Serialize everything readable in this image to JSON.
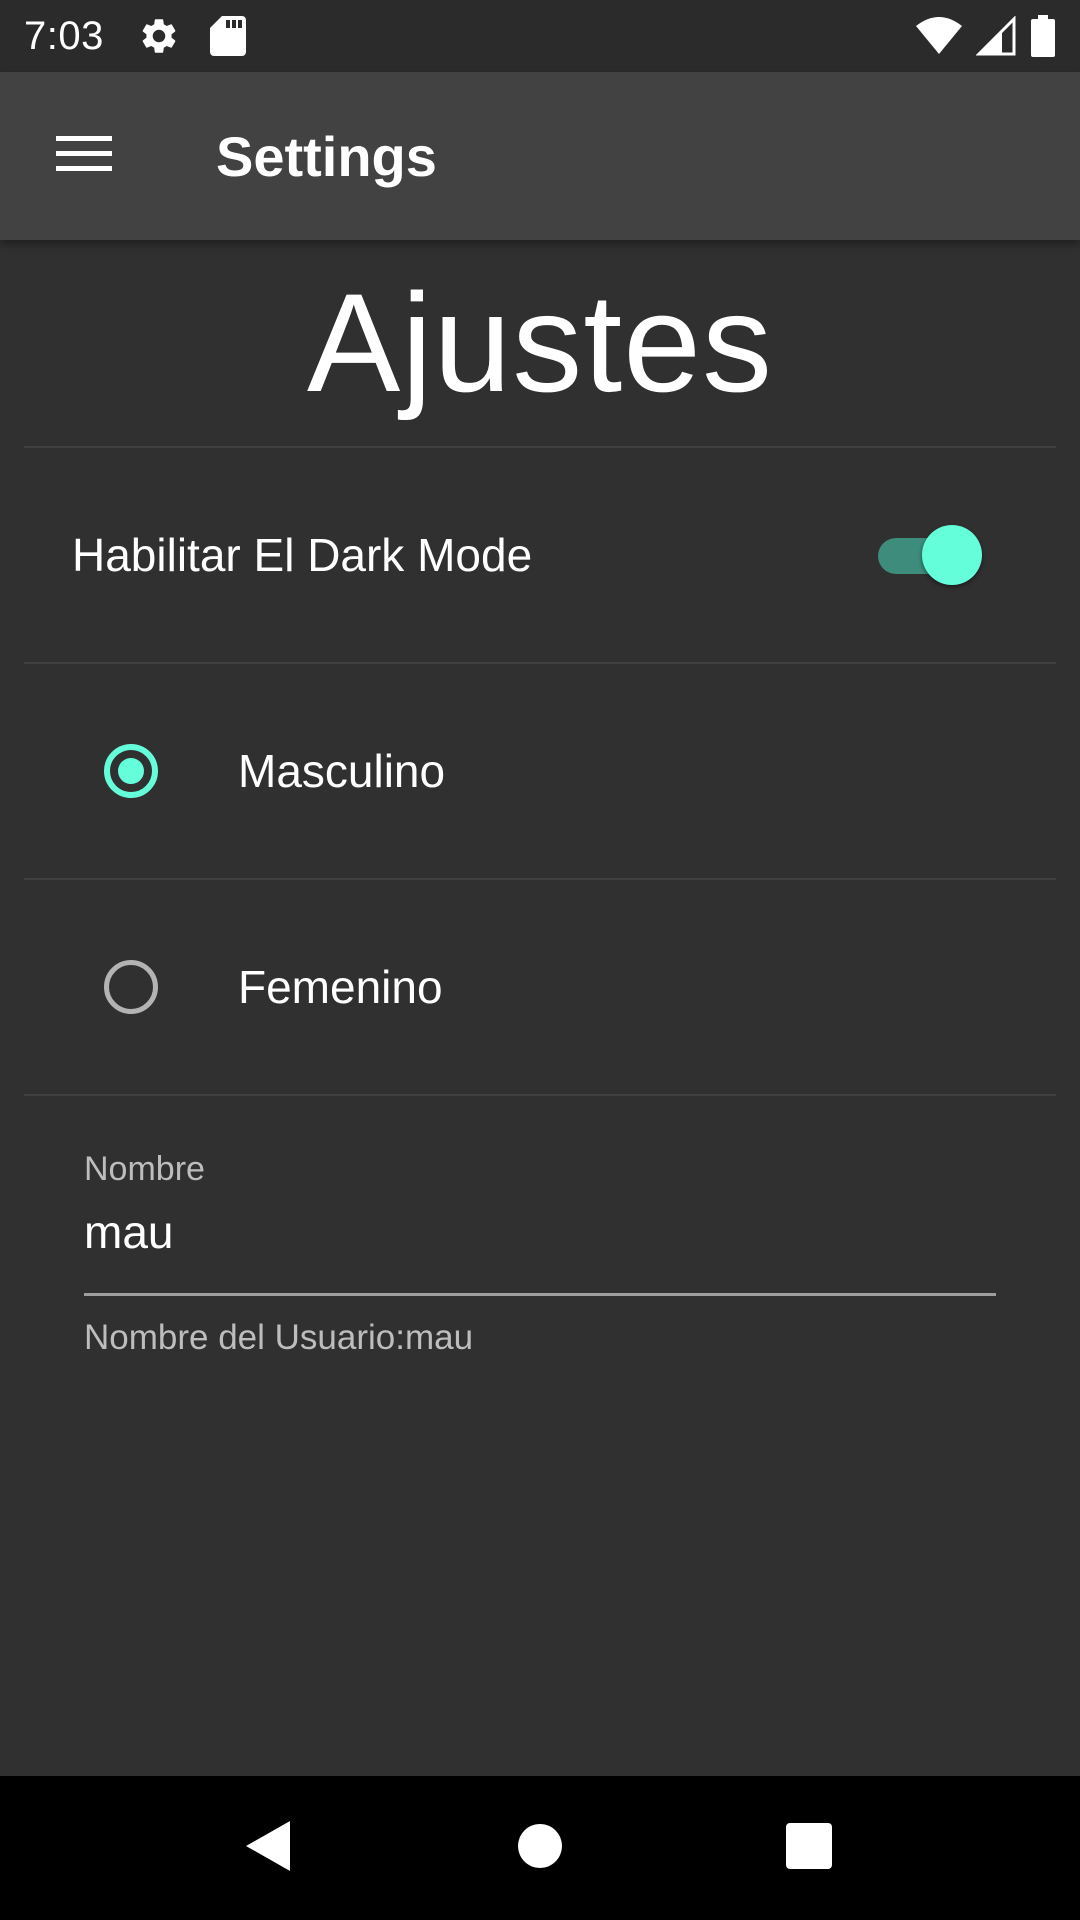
{
  "status_bar": {
    "time": "7:03",
    "left_icons": [
      "settings-gear-icon",
      "sd-card-icon"
    ],
    "right_icons": [
      "wifi-icon",
      "cellular-signal-icon",
      "battery-icon"
    ]
  },
  "app_bar": {
    "menu_icon": "hamburger-menu-icon",
    "title": "Settings"
  },
  "content": {
    "heading": "Ajustes",
    "dark_mode": {
      "label": "Habilitar El Dark Mode",
      "enabled": true
    },
    "gender_options": [
      {
        "label": "Masculino",
        "selected": true
      },
      {
        "label": "Femenino",
        "selected": false
      }
    ],
    "name_field": {
      "label": "Nombre",
      "value": "mau",
      "helper": "Nombre del Usuario:mau"
    }
  },
  "nav_bar": {
    "icons": [
      "back-icon",
      "home-icon",
      "recents-icon"
    ]
  },
  "colors": {
    "accent": "#64ffda",
    "accent_track": "#3e8c7c",
    "background": "#303030",
    "app_bar": "#424242",
    "status_bar": "#2b2b2b"
  }
}
